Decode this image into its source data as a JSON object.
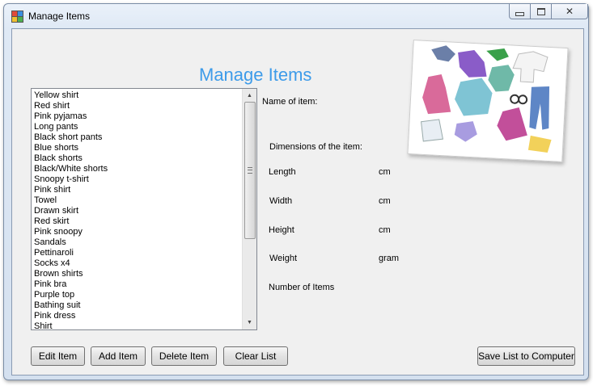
{
  "window": {
    "title": "Manage Items"
  },
  "heading": "Manage Items",
  "items_list": [
    "Yellow shirt",
    "Red shirt",
    "Pink pyjamas",
    "Long pants",
    "Black short pants",
    "Blue shorts",
    "Black shorts",
    "Black/White shorts",
    "Snoopy t-shirt",
    "Pink shirt",
    "Towel",
    "Drawn skirt",
    "Red skirt",
    "Pink snoopy",
    "Sandals",
    "Pettinaroli",
    "Socks x4",
    "Brown shirts",
    "Pink bra",
    "Purple top",
    "Bathing suit",
    "Pink dress",
    "Shirt"
  ],
  "details": {
    "name_label": "Name of item:",
    "dimensions_label": "Dimensions of the item:",
    "length_label": "Length",
    "length_unit": "cm",
    "width_label": "Width",
    "width_unit": "cm",
    "height_label": "Height",
    "height_unit": "cm",
    "weight_label": "Weight",
    "weight_unit": "gram",
    "count_label": "Number of Items"
  },
  "buttons": {
    "edit": "Edit Item",
    "add": "Add Item",
    "delete": "Delete Item",
    "clear": "Clear List",
    "save": "Save List to Computer"
  },
  "icons": {
    "app": "app-window-icon",
    "minimize": "minimize-icon",
    "maximize": "maximize-icon",
    "close": "close-icon",
    "scroll_up": "scroll-up-arrow-icon",
    "scroll_down": "scroll-down-arrow-icon"
  },
  "colors": {
    "heading": "#3d9be9"
  }
}
